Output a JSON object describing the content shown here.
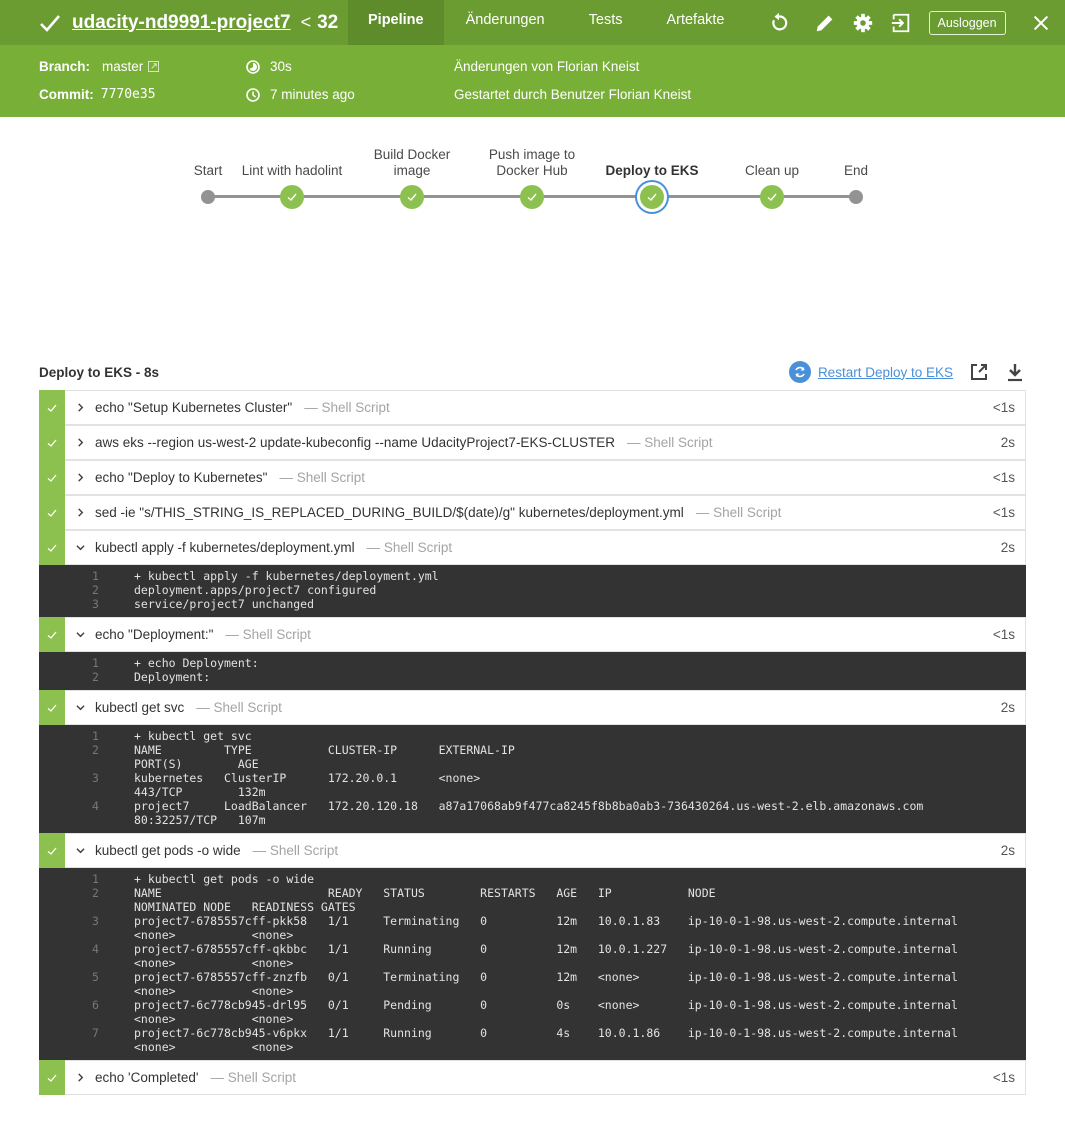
{
  "header": {
    "title": "udacity-nd9991-project7",
    "run_separator": "<",
    "run_number": "32",
    "status_icon": "check-icon",
    "tabs": [
      {
        "label": "Pipeline",
        "active": true
      },
      {
        "label": "Änderungen",
        "active": false
      },
      {
        "label": "Tests",
        "active": false
      },
      {
        "label": "Artefakte",
        "active": false
      }
    ],
    "actions": [
      "rerun-icon",
      "edit-icon",
      "settings-icon",
      "exit-icon"
    ],
    "logout_label": "Ausloggen",
    "close_icon": "close-icon",
    "colors": {
      "topbar": "#6b9c32",
      "infobar": "#78b037",
      "success": "#8cc04f",
      "link": "#4a90d9"
    }
  },
  "info": {
    "branch_label": "Branch:",
    "branch_value": "master",
    "commit_label": "Commit:",
    "commit_value": "7770e35",
    "duration": "30s",
    "started": "7 minutes ago",
    "changes_by": "Änderungen von Florian Kneist",
    "started_by": "Gestartet durch Benutzer Florian Kneist"
  },
  "pipeline": {
    "stages": [
      {
        "label": "Start",
        "label2": "",
        "type": "endpoint"
      },
      {
        "label": "Lint with hadolint",
        "label2": "",
        "type": "success"
      },
      {
        "label": "Build Docker",
        "label2": "image",
        "type": "success"
      },
      {
        "label": "Push image to",
        "label2": "Docker Hub",
        "type": "success"
      },
      {
        "label": "Deploy to EKS",
        "label2": "",
        "type": "success",
        "selected": true
      },
      {
        "label": "Clean up",
        "label2": "",
        "type": "success"
      },
      {
        "label": "End",
        "label2": "",
        "type": "endpoint"
      }
    ]
  },
  "steps_panel": {
    "title": "Deploy to EKS - 8s",
    "restart_label": "Restart Deploy to EKS",
    "steps": [
      {
        "cmd": "echo \"Setup Kubernetes Cluster\"",
        "kind": "— Shell Script",
        "duration": "<1s",
        "expanded": false
      },
      {
        "cmd": "aws eks --region us-west-2 update-kubeconfig --name UdacityProject7-EKS-CLUSTER",
        "kind": "— Shell Script",
        "duration": "2s",
        "expanded": false
      },
      {
        "cmd": "echo \"Deploy to Kubernetes\"",
        "kind": "— Shell Script",
        "duration": "<1s",
        "expanded": false
      },
      {
        "cmd": "sed -ie \"s/THIS_STRING_IS_REPLACED_DURING_BUILD/$(date)/g\" kubernetes/deployment.yml",
        "kind": "— Shell Script",
        "duration": "<1s",
        "expanded": false
      },
      {
        "cmd": "kubectl apply -f kubernetes/deployment.yml",
        "kind": "— Shell Script",
        "duration": "2s",
        "expanded": true,
        "log": [
          {
            "n": "1",
            "lines": [
              "+ kubectl apply -f kubernetes/deployment.yml"
            ]
          },
          {
            "n": "2",
            "lines": [
              "deployment.apps/project7 configured"
            ]
          },
          {
            "n": "3",
            "lines": [
              "service/project7 unchanged"
            ]
          }
        ]
      },
      {
        "cmd": "echo \"Deployment:\"",
        "kind": "— Shell Script",
        "duration": "<1s",
        "expanded": true,
        "log": [
          {
            "n": "1",
            "lines": [
              "+ echo Deployment:"
            ]
          },
          {
            "n": "2",
            "lines": [
              "Deployment:"
            ]
          }
        ]
      },
      {
        "cmd": "kubectl get svc",
        "kind": "— Shell Script",
        "duration": "2s",
        "expanded": true,
        "log": [
          {
            "n": "1",
            "lines": [
              "+ kubectl get svc"
            ]
          },
          {
            "n": "2",
            "lines": [
              "NAME         TYPE           CLUSTER-IP      EXTERNAL-IP",
              "PORT(S)        AGE"
            ]
          },
          {
            "n": "3",
            "lines": [
              "kubernetes   ClusterIP      172.20.0.1      <none>",
              "443/TCP        132m"
            ]
          },
          {
            "n": "4",
            "lines": [
              "project7     LoadBalancer   172.20.120.18   a87a17068ab9f477ca8245f8b8ba0ab3-736430264.us-west-2.elb.amazonaws.com",
              "80:32257/TCP   107m"
            ]
          }
        ]
      },
      {
        "cmd": "kubectl get pods -o wide",
        "kind": "— Shell Script",
        "duration": "2s",
        "expanded": true,
        "log": [
          {
            "n": "1",
            "lines": [
              "+ kubectl get pods -o wide"
            ]
          },
          {
            "n": "2",
            "lines": [
              "NAME                        READY   STATUS        RESTARTS   AGE   IP           NODE",
              "NOMINATED NODE   READINESS GATES"
            ]
          },
          {
            "n": "3",
            "lines": [
              "project7-6785557cff-pkk58   1/1     Terminating   0          12m   10.0.1.83    ip-10-0-1-98.us-west-2.compute.internal",
              "<none>           <none>"
            ]
          },
          {
            "n": "4",
            "lines": [
              "project7-6785557cff-qkbbc   1/1     Running       0          12m   10.0.1.227   ip-10-0-1-98.us-west-2.compute.internal",
              "<none>           <none>"
            ]
          },
          {
            "n": "5",
            "lines": [
              "project7-6785557cff-znzfb   0/1     Terminating   0          12m   <none>       ip-10-0-1-98.us-west-2.compute.internal",
              "<none>           <none>"
            ]
          },
          {
            "n": "6",
            "lines": [
              "project7-6c778cb945-drl95   0/1     Pending       0          0s    <none>       ip-10-0-1-98.us-west-2.compute.internal",
              "<none>           <none>"
            ]
          },
          {
            "n": "7",
            "lines": [
              "project7-6c778cb945-v6pkx   1/1     Running       0          4s    10.0.1.86    ip-10-0-1-98.us-west-2.compute.internal",
              "<none>           <none>"
            ]
          }
        ]
      },
      {
        "cmd": "echo 'Completed'",
        "kind": "— Shell Script",
        "duration": "<1s",
        "expanded": false
      }
    ]
  }
}
